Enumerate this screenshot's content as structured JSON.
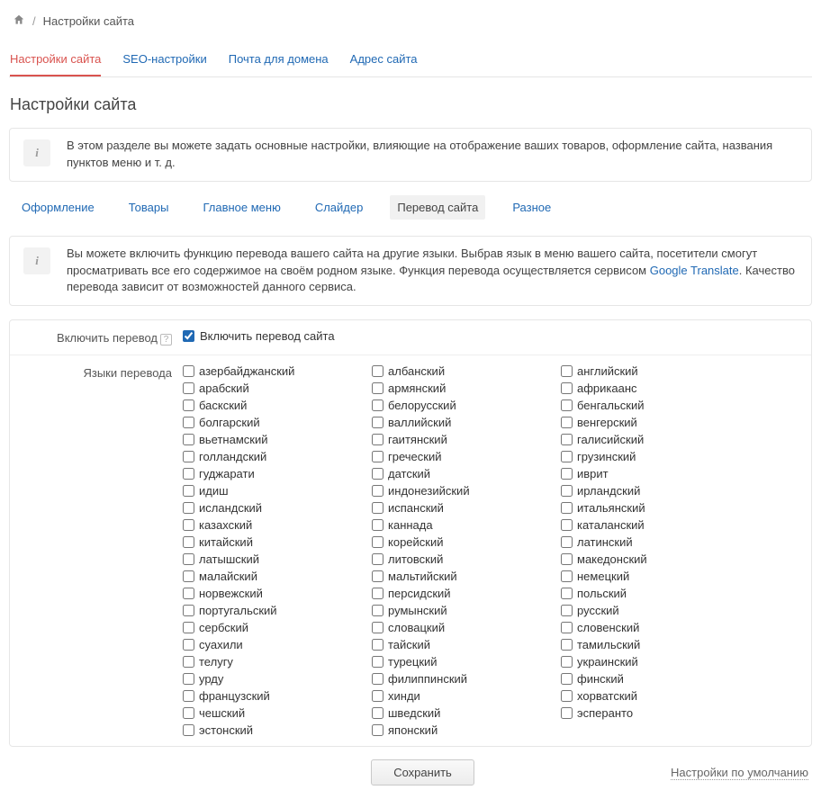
{
  "breadcrumb": {
    "current": "Настройки сайта"
  },
  "mainTabs": [
    {
      "label": "Настройки сайта",
      "active": true
    },
    {
      "label": "SEO-настройки",
      "active": false
    },
    {
      "label": "Почта для домена",
      "active": false
    },
    {
      "label": "Адрес сайта",
      "active": false
    }
  ],
  "pageTitle": "Настройки сайта",
  "infoTop": "В этом разделе вы можете задать основные настройки, влияющие на отображение ваших товаров, оформление сайта, названия пунктов меню и т. д.",
  "subTabs": [
    {
      "label": "Оформление",
      "active": false
    },
    {
      "label": "Товары",
      "active": false
    },
    {
      "label": "Главное меню",
      "active": false
    },
    {
      "label": "Слайдер",
      "active": false
    },
    {
      "label": "Перевод сайта",
      "active": true
    },
    {
      "label": "Разное",
      "active": false
    }
  ],
  "infoTranslate": {
    "part1": "Вы можете включить функцию перевода вашего сайта на другие языки. Выбрав язык в меню вашего сайта, посетители смогут просматривать все его содержимое на своём родном языке. Функция перевода осуществляется сервисом ",
    "link": "Google Translate",
    "part2": ". Качество перевода зависит от возможностей данного сервиса."
  },
  "form": {
    "enableLabel": "Включить перевод",
    "enableCheckboxLabel": "Включить перевод сайта",
    "langsLabel": "Языки перевода"
  },
  "languages": [
    "азербайджанский",
    "албанский",
    "английский",
    "арабский",
    "армянский",
    "африкаанс",
    "баскский",
    "белорусский",
    "бенгальский",
    "болгарский",
    "валлийский",
    "венгерский",
    "вьетнамский",
    "гаитянский",
    "галисийский",
    "голландский",
    "греческий",
    "грузинский",
    "гуджарати",
    "датский",
    "иврит",
    "идиш",
    "индонезийский",
    "ирландский",
    "исландский",
    "испанский",
    "итальянский",
    "казахский",
    "каннада",
    "каталанский",
    "китайский",
    "корейский",
    "латинский",
    "латышский",
    "литовский",
    "македонский",
    "малайский",
    "мальтийский",
    "немецкий",
    "норвежский",
    "персидский",
    "польский",
    "португальский",
    "румынский",
    "русский",
    "сербский",
    "словацкий",
    "словенский",
    "суахили",
    "тайский",
    "тамильский",
    "телугу",
    "турецкий",
    "украинский",
    "урду",
    "филиппинский",
    "финский",
    "французский",
    "хинди",
    "хорватский",
    "чешский",
    "шведский",
    "эсперанто",
    "эстонский",
    "японский"
  ],
  "saveButton": "Сохранить",
  "defaultsLink": "Настройки по умолчанию"
}
